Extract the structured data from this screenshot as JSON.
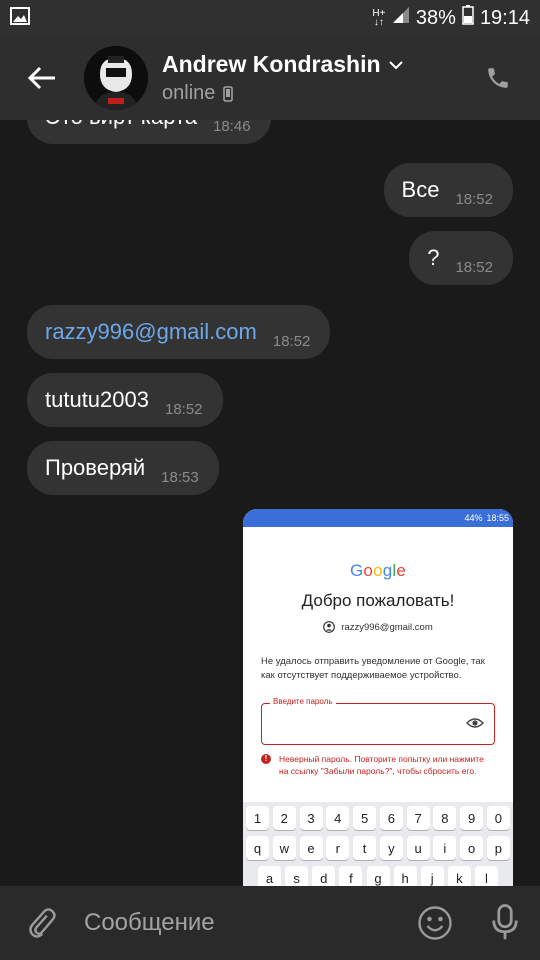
{
  "status_bar": {
    "network_type_top": "H+",
    "network_type_bottom": "↓↑",
    "battery": "38%",
    "time": "19:14",
    "icons": [
      "image-icon",
      "signal-icon",
      "battery-icon"
    ]
  },
  "header": {
    "contact_name": "Andrew Kondrashin",
    "status": "online",
    "icons": [
      "back-arrow-icon",
      "chevron-down-icon",
      "mobile-device-icon",
      "phone-call-icon"
    ]
  },
  "messages": [
    {
      "text": "Это вирт карта",
      "time": "18:46",
      "side": "in"
    },
    {
      "text": "Все",
      "time": "18:52",
      "side": "out"
    },
    {
      "text": "?",
      "time": "18:52",
      "side": "out"
    },
    {
      "text": "razzy996@gmail.com",
      "time": "18:52",
      "side": "in",
      "is_link": true
    },
    {
      "text": "tututu2003",
      "time": "18:52",
      "side": "in"
    },
    {
      "text": "Проверяй",
      "time": "18:53",
      "side": "in"
    }
  ],
  "screenshot": {
    "status": {
      "battery": "44%",
      "time": "18:55"
    },
    "logo": "Google",
    "title": "Добро пожаловать!",
    "account": "razzy996@gmail.com",
    "message": "Не удалось отправить уведомление от Google, так как отсутствует поддерживаемое устройство.",
    "field_label": "Введите пароль",
    "error": "Неверный пароль. Повторите попытку или нажмите на ссылку \"Забыли пароль?\", чтобы сбросить его.",
    "keyboard_rows": [
      [
        "1",
        "2",
        "3",
        "4",
        "5",
        "6",
        "7",
        "8",
        "9",
        "0"
      ],
      [
        "q",
        "w",
        "e",
        "r",
        "t",
        "y",
        "u",
        "i",
        "o",
        "p"
      ],
      [
        "a",
        "s",
        "d",
        "f",
        "g",
        "h",
        "j",
        "k",
        "l"
      ]
    ],
    "colors": {
      "logo": [
        "#4285f4",
        "#ea4335",
        "#fbbc05",
        "#4285f4",
        "#34a853",
        "#ea4335"
      ],
      "error": "#c5221f",
      "status_bar": "#3b6fd8"
    }
  },
  "composer": {
    "placeholder": "Сообщение",
    "icons": [
      "paperclip-icon",
      "emoji-icon",
      "microphone-icon"
    ]
  },
  "colors": {
    "background": "#1a1a1a",
    "header": "#2e2e2e",
    "bubble": "#333333",
    "link": "#6ea8ea",
    "muted": "#8a8a8a"
  }
}
